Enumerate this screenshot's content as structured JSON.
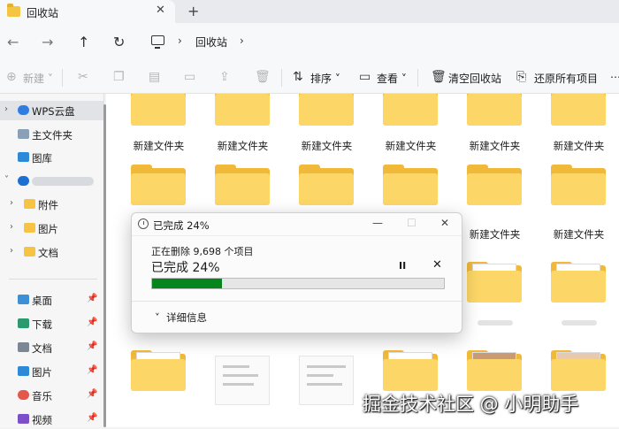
{
  "window": {
    "tab_title": "回收站",
    "close_tab": "✕",
    "new_tab": "+"
  },
  "address": {
    "back": "←",
    "forward": "→",
    "up": "↑",
    "refresh": "↻",
    "separator": "›",
    "crumb": "回收站"
  },
  "toolbar": {
    "new_label": "新建",
    "sort_label": "排序",
    "view_label": "查看",
    "empty_bin_label": "清空回收站",
    "restore_all_label": "还原所有项目",
    "more": "⋯"
  },
  "sidebar": {
    "items": [
      {
        "label": "WPS云盘",
        "icon": "cloud-icon"
      },
      {
        "label": "主文件夹",
        "icon": "home-icon"
      },
      {
        "label": "图库",
        "icon": "gallery-icon"
      },
      {
        "label": "",
        "icon": "onedrive-icon"
      },
      {
        "label": "附件",
        "icon": "folder-icon"
      },
      {
        "label": "图片",
        "icon": "folder-icon"
      },
      {
        "label": "文档",
        "icon": "folder-icon"
      },
      {
        "label": "桌面",
        "icon": "desktop-icon"
      },
      {
        "label": "下载",
        "icon": "download-icon"
      },
      {
        "label": "文档",
        "icon": "document-icon"
      },
      {
        "label": "图片",
        "icon": "picture-icon"
      },
      {
        "label": "音乐",
        "icon": "music-icon"
      },
      {
        "label": "视频",
        "icon": "video-icon"
      }
    ]
  },
  "files": {
    "folder_label": "新建文件夹"
  },
  "dialog": {
    "title": "已完成 24%",
    "subtitle": "正在删除 9,698 个项目",
    "status": "已完成 24%",
    "progress_percent": 24,
    "pause": "II",
    "stop": "✕",
    "details": "详细信息",
    "minimize": "—",
    "maximize": "☐",
    "close": "✕"
  },
  "watermark": "掘金技术社区 @ 小明助手",
  "colors": {
    "progress": "#06841d",
    "folder": "#fcd666"
  }
}
